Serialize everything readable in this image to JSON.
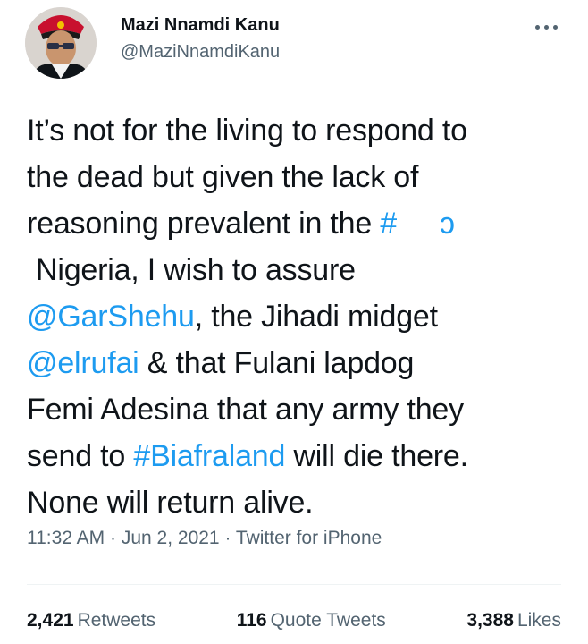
{
  "author": {
    "display_name": "Mazi Nnamdi Kanu",
    "handle": "@MaziNnamdiKanu",
    "avatar_icon": "profile-photo"
  },
  "more_icon": "more-horizontal-icon",
  "tweet": {
    "lines": [
      [
        {
          "text": "It’s not for the living to respond to",
          "type": "text"
        }
      ],
      [
        {
          "text": "the dead but given the lack of",
          "type": "text"
        }
      ],
      [
        {
          "text": "reasoning prevalent in the ",
          "type": "text"
        },
        {
          "text": "#",
          "type": "link"
        }
      ],
      [
        {
          "text": "Nigeria, I wish to assure",
          "type": "text"
        }
      ],
      [
        {
          "text": "@GarShehu",
          "type": "link"
        },
        {
          "text": ", the Jihadi midget",
          "type": "text"
        }
      ],
      [
        {
          "text": "@elrufai",
          "type": "link"
        },
        {
          "text": " & that Fulani lapdog",
          "type": "text"
        }
      ],
      [
        {
          "text": "Femi Adesina that any army they",
          "type": "text"
        }
      ],
      [
        {
          "text": "send to ",
          "type": "text"
        },
        {
          "text": "#Biafraland",
          "type": "link"
        },
        {
          "text": " will die there.",
          "type": "text"
        }
      ],
      [
        {
          "text": "None will return alive.",
          "type": "text"
        }
      ]
    ]
  },
  "meta": {
    "time": "11:32 AM",
    "sep1": " · ",
    "date": "Jun 2, 2021",
    "sep2": " · ",
    "source": "Twitter for iPhone"
  },
  "stats": {
    "retweets_count": "2,421",
    "retweets_label": "Retweets",
    "quotes_count": "116",
    "quotes_label": "Quote Tweets",
    "likes_count": "3,388",
    "likes_label": "Likes"
  },
  "colors": {
    "link": "#1d9bf0",
    "secondary": "#536471",
    "primary": "#0f1419"
  }
}
